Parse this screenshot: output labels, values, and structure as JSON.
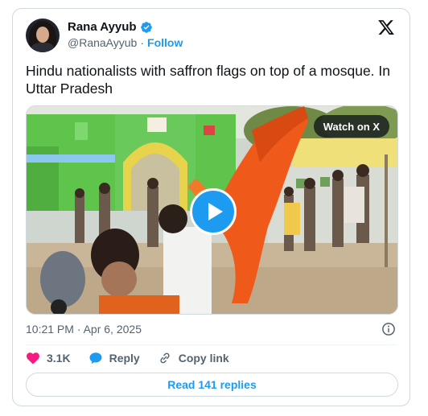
{
  "author": {
    "name": "Rana Ayyub",
    "handle": "@RanaAyyub",
    "follow_label": "Follow",
    "separator": "·"
  },
  "tweet": {
    "text": "Hindu nationalists with saffron flags on top of a mosque. In Uttar Pradesh",
    "timestamp": "10:21 PM · Apr 6, 2025"
  },
  "media": {
    "watch_label": "Watch on X"
  },
  "actions": {
    "likes": "3.1K",
    "reply_label": "Reply",
    "copy_link_label": "Copy link"
  },
  "replies_button": "Read 141 replies",
  "colors": {
    "accent": "#1d9bf0",
    "like": "#f91880",
    "text_secondary": "#536471",
    "border": "#cfd9de"
  }
}
